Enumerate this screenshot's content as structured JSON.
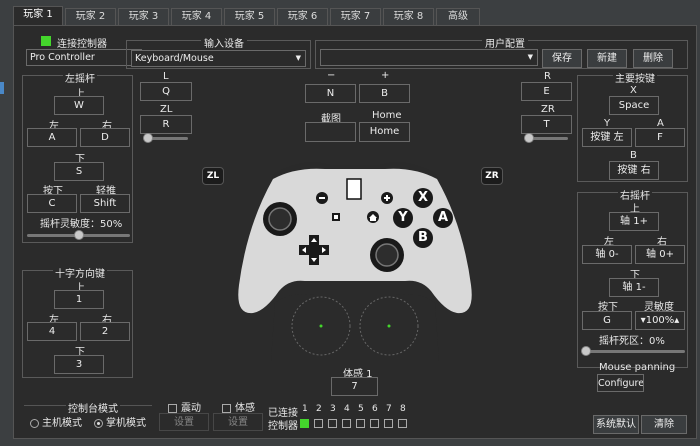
{
  "tabs": [
    "玩家 1",
    "玩家 2",
    "玩家 3",
    "玩家 4",
    "玩家 5",
    "玩家 6",
    "玩家 7",
    "玩家 8",
    "高级"
  ],
  "connect": {
    "label": "连接控制器",
    "controller_type": "Pro Controller"
  },
  "input_device": {
    "label": "输入设备",
    "value": "Keyboard/Mouse"
  },
  "user_config": {
    "label": "用户配置",
    "value": "",
    "save": "保存",
    "new": "新建",
    "delete": "删除"
  },
  "left_stick": {
    "title": "左摇杆",
    "up_label": "上",
    "up": "W",
    "left_label": "左",
    "left": "A",
    "right_label": "右",
    "right": "D",
    "down_label": "下",
    "down": "S",
    "press_label": "按下",
    "press": "C",
    "modifier_label": "轻推",
    "modifier": "Shift",
    "sensitivity": "摇杆灵敏度：50%"
  },
  "dpad": {
    "title": "十字方向键",
    "up_label": "上",
    "up": "1",
    "left_label": "左",
    "left": "4",
    "right_label": "右",
    "right": "2",
    "down_label": "下",
    "down": "3"
  },
  "shoulder_left": {
    "l_label": "L",
    "l": "Q",
    "zl_label": "ZL",
    "zl": "R"
  },
  "minus_plus": {
    "minus_label": "−",
    "minus": "N",
    "plus_label": "+",
    "plus": "B"
  },
  "capture_home": {
    "capture_label": "截图",
    "capture": "",
    "home_label": "Home",
    "home": "Home"
  },
  "shoulder_right": {
    "r_label": "R",
    "r": "E",
    "zr_label": "ZR",
    "zr": "T"
  },
  "face_buttons": {
    "title": "主要按键",
    "x_label": "X",
    "x": "Space",
    "y_label": "Y",
    "y": "按键 左",
    "a_label": "A",
    "a": "F",
    "b_label": "B",
    "b": "按键 右"
  },
  "right_stick": {
    "title": "右摇杆",
    "up_label": "上",
    "up": "轴 1+",
    "left_label": "左",
    "left": "轴 0-",
    "right_label": "右",
    "right": "轴 0+",
    "down_label": "下",
    "down": "轴 1-",
    "press_label": "按下",
    "press": "G",
    "sens_label": "灵敏度",
    "sens": "100%",
    "deadzone": "摇杆死区：0%",
    "mouse_label": "Mouse panning",
    "configure": "Configure"
  },
  "controller_image": {
    "zl": "ZL",
    "zr": "ZR",
    "x": "X",
    "y": "Y",
    "a": "A",
    "b": "B"
  },
  "motion": {
    "label": "体感 1",
    "value": "7"
  },
  "console_mode": {
    "title": "控制台模式",
    "docked": "主机模式",
    "handheld": "掌机模式",
    "selected": "handheld",
    "config1": "设置",
    "config2": "设置"
  },
  "vibration": {
    "label": "震动",
    "checked": false
  },
  "motion_chk": {
    "label": "体感",
    "checked": false
  },
  "connected": {
    "label1": "已连接",
    "label2": "控制器",
    "numbers": [
      "1",
      "2",
      "3",
      "4",
      "5",
      "6",
      "7",
      "8"
    ],
    "active": [
      true,
      false,
      false,
      false,
      false,
      false,
      false,
      false
    ]
  },
  "footer": {
    "defaults": "系统默认",
    "clear": "清除"
  },
  "colors": {
    "accent_green": "#44d62c",
    "bg": "#2b2b2b"
  }
}
